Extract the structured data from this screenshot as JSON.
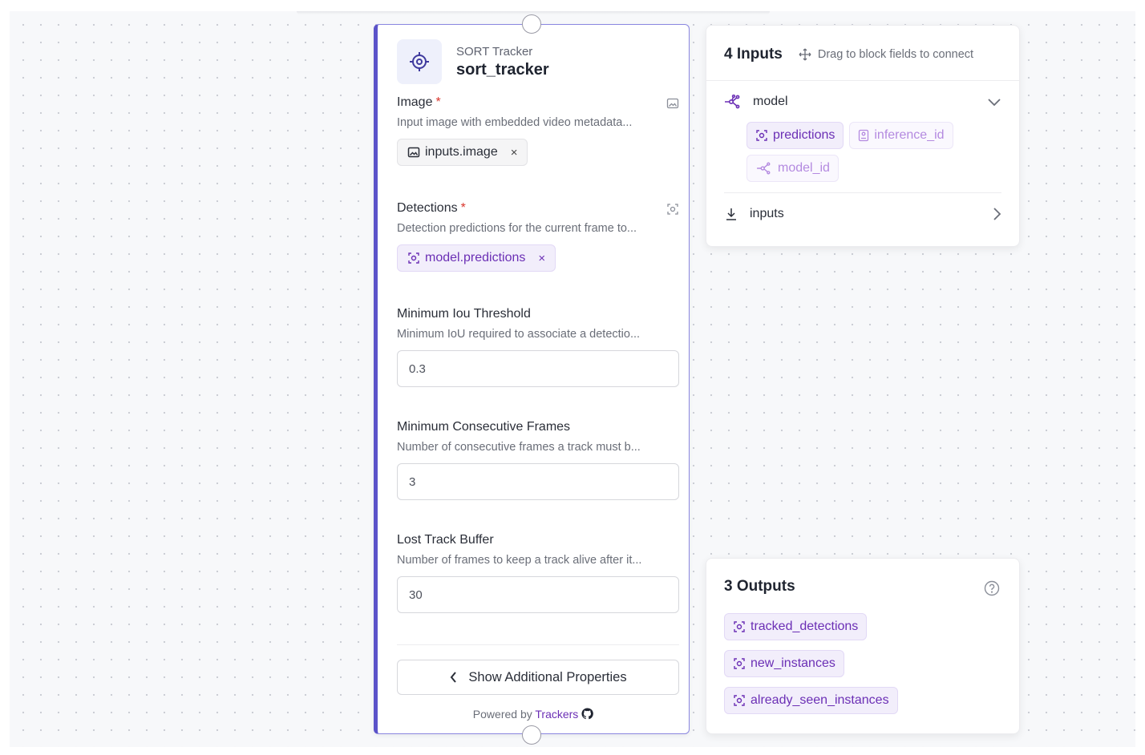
{
  "node": {
    "type": "SORT Tracker",
    "name": "sort_tracker",
    "fields": [
      {
        "label": "Image",
        "required": true,
        "description": "Input image with embedded video metadata...",
        "chip": "inputs.image"
      },
      {
        "label": "Detections",
        "required": true,
        "description": "Detection predictions for the current frame to...",
        "chip": "model.predictions"
      },
      {
        "label": "Minimum Iou Threshold",
        "description": "Minimum IoU required to associate a detectio...",
        "value": "0.3"
      },
      {
        "label": "Minimum Consecutive Frames",
        "description": "Number of consecutive frames a track must b...",
        "value": "3"
      },
      {
        "label": "Lost Track Buffer",
        "description": "Number of frames to keep a track alive after it...",
        "value": "30"
      }
    ],
    "required_marker": "*",
    "remove_symbol": "×",
    "additional_button": "Show Additional Properties",
    "powered_prefix": "Powered by",
    "powered_link": "Trackers"
  },
  "inputs_card": {
    "title": "4 Inputs",
    "hint": "Drag to block fields to connect",
    "groups": [
      {
        "name": "model",
        "expanded": true,
        "chips": [
          "predictions",
          "inference_id",
          "model_id"
        ]
      },
      {
        "name": "inputs",
        "expanded": false
      }
    ]
  },
  "outputs_card": {
    "title": "3 Outputs",
    "chips": [
      "tracked_detections",
      "new_instances",
      "already_seen_instances"
    ]
  },
  "colors": {
    "accent": "#5b53c9",
    "purple": "#6b2fb5",
    "required": "#d9342b"
  }
}
